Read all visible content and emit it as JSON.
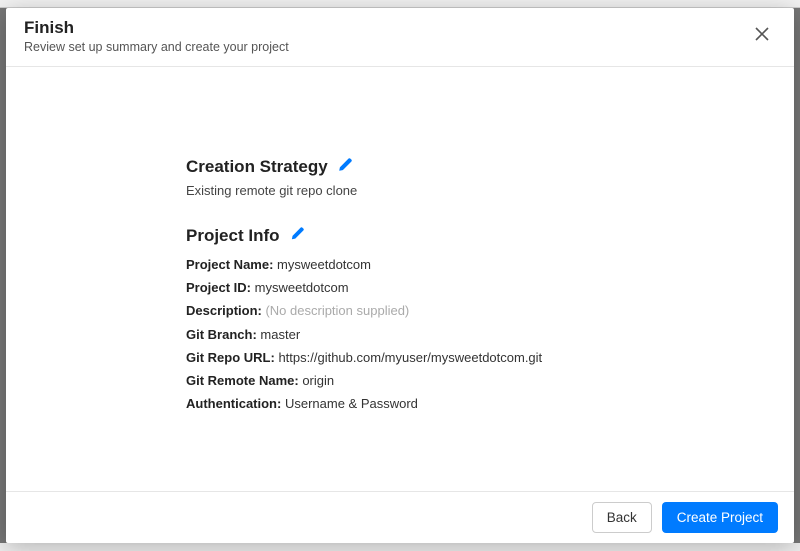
{
  "header": {
    "title": "Finish",
    "subtitle": "Review set up summary and create your project"
  },
  "creation_strategy": {
    "heading": "Creation Strategy",
    "value": "Existing remote git repo clone"
  },
  "project_info": {
    "heading": "Project Info",
    "rows": [
      {
        "label": "Project Name:",
        "value": "mysweetdotcom",
        "muted": false
      },
      {
        "label": "Project ID:",
        "value": "mysweetdotcom",
        "muted": false
      },
      {
        "label": "Description:",
        "value": "(No description supplied)",
        "muted": true
      },
      {
        "label": "Git Branch:",
        "value": "master",
        "muted": false
      },
      {
        "label": "Git Repo URL:",
        "value": "https://github.com/myuser/mysweetdotcom.git",
        "muted": false
      },
      {
        "label": "Git Remote Name:",
        "value": "origin",
        "muted": false
      },
      {
        "label": "Authentication:",
        "value": "Username & Password",
        "muted": false
      }
    ]
  },
  "footer": {
    "back": "Back",
    "create": "Create Project"
  }
}
